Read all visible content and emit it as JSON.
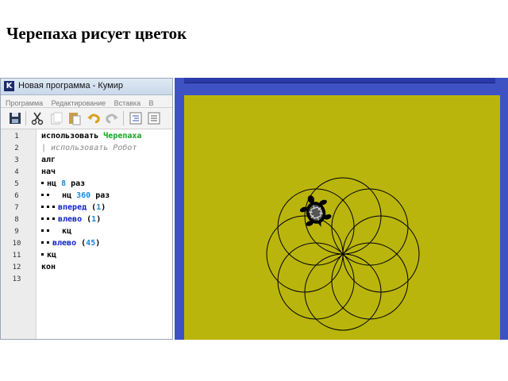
{
  "slide": {
    "title": "Черепаха рисует цветок"
  },
  "window": {
    "title": "Новая программа - Кумир",
    "app_letter": "K",
    "menu": [
      "Программа",
      "Редактирование",
      "Вставка",
      "В"
    ]
  },
  "toolbar": {
    "buttons": [
      "save-icon",
      "cut-icon",
      "copy-icon",
      "paste-icon",
      "undo-icon",
      "redo-icon",
      "indent-icon",
      "list-icon"
    ]
  },
  "editor": {
    "line_numbers": [
      "1",
      "2",
      "3",
      "4",
      "5",
      "6",
      "7",
      "8",
      "9",
      "10",
      "11",
      "12",
      "13"
    ],
    "lines": {
      "l1_kw": "использовать",
      "l1_name": "Черепаха",
      "l2": "| использовать Робот",
      "l3": "алг",
      "l4": "нач",
      "l5_kw": "нц",
      "l5_num": "8",
      "l5_end": "раз",
      "l6_kw": "нц",
      "l6_num": "360",
      "l6_end": "раз",
      "l7_cmd": "вперед",
      "l7_open": "(",
      "l7_num": "1",
      "l7_close": ")",
      "l8_cmd": "влево",
      "l8_open": "(",
      "l8_num": "1",
      "l8_close": ")",
      "l9": "кц",
      "l10_cmd": "влево",
      "l10_open": "(",
      "l10_num": "45",
      "l10_close": ")",
      "l11": "кц",
      "l12": "кон"
    }
  },
  "drawing": {
    "petals": 8,
    "rotation_step_deg": 45,
    "field_color": "#bab50c",
    "frame_color": "#3f52c4",
    "line_color": "#000000"
  }
}
